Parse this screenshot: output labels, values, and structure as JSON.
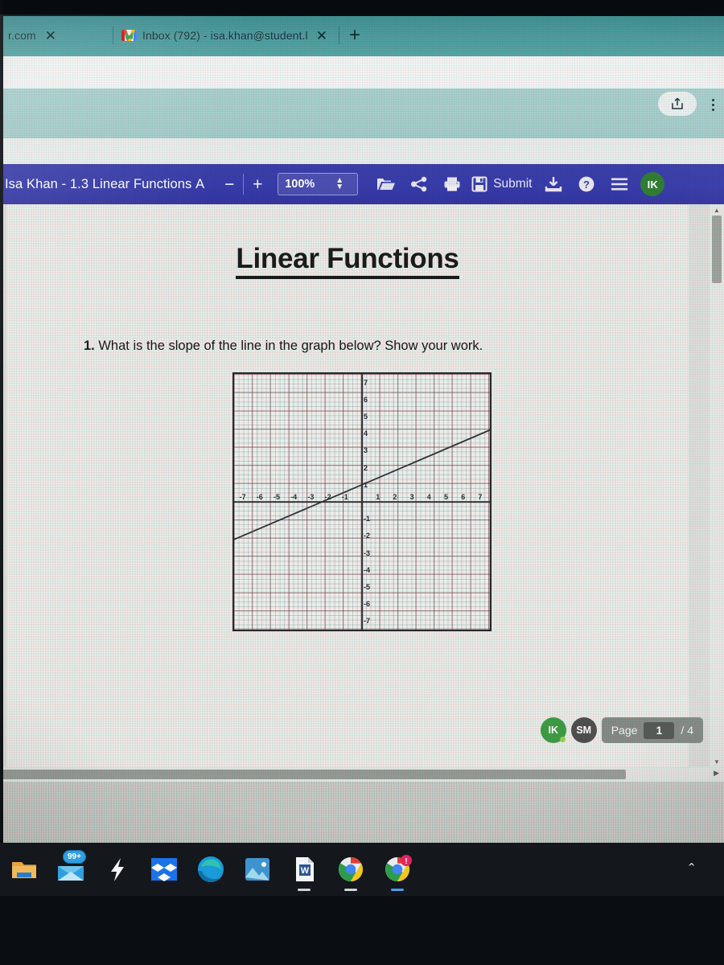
{
  "browser": {
    "tabs": [
      {
        "title": "r.com",
        "favicon": "none",
        "close_label": "✕"
      },
      {
        "title": "Inbox (792) - isa.khan@student.l",
        "favicon": "gmail-icon",
        "close_label": "✕"
      }
    ],
    "new_tab_label": "+",
    "share_icon": "share-icon",
    "menu_icon": "kebab-menu-icon"
  },
  "app_toolbar": {
    "document_title": "Isa Khan - 1.3 Linear Functions А",
    "zoom_out_label": "−",
    "zoom_in_label": "+",
    "zoom_value": "100%",
    "spinner_label": "↕",
    "tools": [
      {
        "name": "open-folder-icon",
        "label": ""
      },
      {
        "name": "share-icon",
        "label": ""
      },
      {
        "name": "print-icon",
        "label": ""
      }
    ],
    "submit_label": "Submit",
    "submit_icon": "save-disk-icon",
    "download_icon": "download-icon",
    "help_icon": "help-icon",
    "menu_icon": "hamburger-menu-icon",
    "avatar_initials": "IK",
    "avatar_color": "#2f7d32"
  },
  "worksheet": {
    "title": "Linear Functions",
    "question_number": "1.",
    "question_text": "What is the slope of the line in the graph below? Show your work."
  },
  "chart_data": {
    "type": "line",
    "title": "",
    "xlabel": "",
    "ylabel": "",
    "xlim": [
      -7.5,
      7.5
    ],
    "ylim": [
      -7.5,
      7.5
    ],
    "grid": true,
    "grid_major_step": 1,
    "grid_minor_step": 0.25,
    "x_ticks": [
      -7,
      -6,
      -5,
      -4,
      -3,
      -2,
      -1,
      1,
      2,
      3,
      4,
      5,
      6,
      7
    ],
    "y_ticks": [
      -7,
      -6,
      -5,
      -4,
      -3,
      -2,
      -1,
      1,
      2,
      3,
      4,
      5,
      6,
      7
    ],
    "x_tick_labels": [
      "-7",
      "-6",
      "-5",
      "-4",
      "-3",
      "-2",
      "-1",
      "1",
      "2",
      "3",
      "4",
      "5",
      "6",
      "7"
    ],
    "y_tick_labels": [
      "-7",
      "-6",
      "-5",
      "-4",
      "-3",
      "-2",
      "-1",
      "1",
      "2",
      "3",
      "4",
      "5",
      "6",
      "7"
    ],
    "series": [
      {
        "name": "line",
        "slope": 0.4286,
        "intercept": 1,
        "points": [
          [
            -7.5,
            -2.21
          ],
          [
            7.5,
            4.21
          ]
        ],
        "color": "#2e3237"
      }
    ]
  },
  "page_controls": {
    "collaborators": [
      {
        "initials": "IK",
        "color": "#3a9a3f",
        "status": "online"
      },
      {
        "initials": "SM",
        "color": "#4a4a4a",
        "status": ""
      }
    ],
    "page_label": "Page",
    "current_page": "1",
    "total_pages": "/ 4"
  },
  "scrollbars": {
    "vertical_up": "▲",
    "vertical_down": "▼",
    "horizontal_right": "▶"
  },
  "taskbar": {
    "items": [
      {
        "name": "file-explorer-icon",
        "badge": ""
      },
      {
        "name": "mail-icon",
        "badge": "99+"
      },
      {
        "name": "lightning-icon",
        "badge": ""
      },
      {
        "name": "dropbox-icon",
        "badge": ""
      },
      {
        "name": "edge-browser-icon",
        "badge": ""
      },
      {
        "name": "photos-icon",
        "badge": ""
      },
      {
        "name": "word-icon",
        "badge": ""
      },
      {
        "name": "chrome-browser-icon",
        "badge": ""
      },
      {
        "name": "chrome-browser-alert-icon",
        "badge": "!"
      }
    ],
    "chevron_label": "⌃"
  }
}
